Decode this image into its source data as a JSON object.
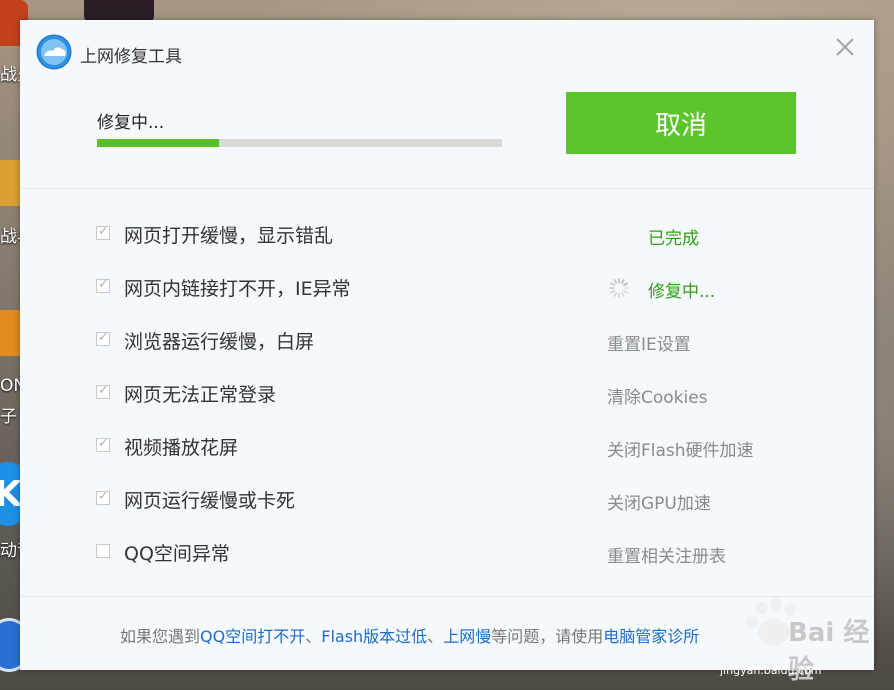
{
  "window": {
    "title": "上网修复工具",
    "close_icon": "close-icon"
  },
  "progress": {
    "status": "修复中...",
    "percent": 30,
    "cancel_label": "取消"
  },
  "items": [
    {
      "label": "网页打开缓慢，显示错乱",
      "checked": true,
      "action": "已完成",
      "state": "done"
    },
    {
      "label": "网页内链接打不开，IE异常",
      "checked": true,
      "action": "修复中...",
      "state": "busy"
    },
    {
      "label": "浏览器运行缓慢，白屏",
      "checked": true,
      "action": "重置IE设置",
      "state": "pending"
    },
    {
      "label": "网页无法正常登录",
      "checked": true,
      "action": "清除Cookies",
      "state": "pending"
    },
    {
      "label": "视频播放花屏",
      "checked": true,
      "action": "关闭Flash硬件加速",
      "state": "pending"
    },
    {
      "label": "网页运行缓慢或卡死",
      "checked": true,
      "action": "关闭GPU加速",
      "state": "pending"
    },
    {
      "label": "QQ空间异常",
      "checked": false,
      "action": "重置相关注册表",
      "state": "pending"
    }
  ],
  "footer": {
    "prefix": "如果您遇到",
    "link1": "QQ空间打不开",
    "sep1": "、",
    "link2": "Flash版本过低",
    "sep2": "、",
    "link3": "上网慢",
    "mid": "等问题，请使用",
    "link4": "电脑管家诊所"
  },
  "desktop": {
    "labels": [
      "战火",
      "战与",
      "ON",
      "子",
      "动音"
    ],
    "watermark_text": "Bai 经验",
    "watermark_url": "jingyan.baidu.com"
  },
  "colors": {
    "accent_green": "#5cc52a",
    "done_green": "#2f9e13",
    "link_blue": "#1a6ec7"
  }
}
